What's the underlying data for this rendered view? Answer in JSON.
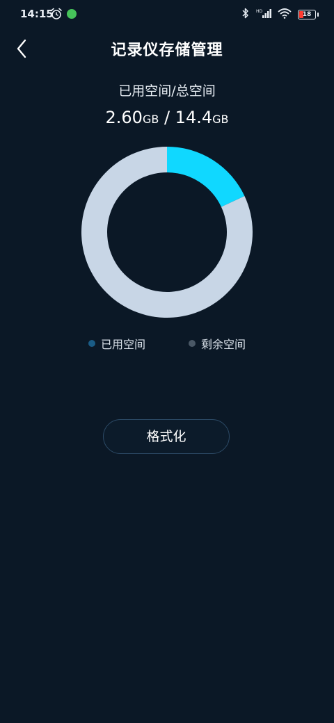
{
  "status_bar": {
    "time": "14:15",
    "battery_level": "18"
  },
  "header": {
    "title": "记录仪存储管理"
  },
  "storage": {
    "caption": "已用空间/总空间",
    "used_value": "2.60",
    "used_unit": "GB",
    "separator": " / ",
    "total_value": "14.4",
    "total_unit": "GB"
  },
  "chart_data": {
    "type": "pie",
    "categories": [
      "已用空间",
      "剩余空间"
    ],
    "values": [
      2.6,
      11.8
    ],
    "colors": [
      "#10d8ff",
      "#c8d6e6"
    ]
  },
  "legend": {
    "used_label": "已用空间",
    "used_color": "#1a5c86",
    "remaining_label": "剩余空间",
    "remaining_color": "#4a5866"
  },
  "actions": {
    "format_label": "格式化"
  },
  "colors": {
    "background": "#0b1826",
    "accent": "#10d8ff"
  }
}
